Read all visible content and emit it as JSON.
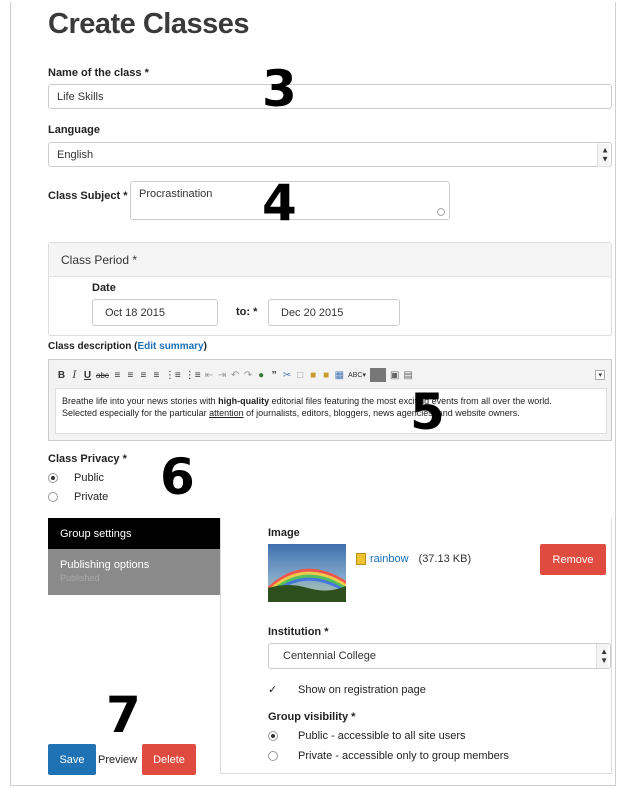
{
  "page": {
    "title": "Create Classes"
  },
  "class_name": {
    "label": "Name of the class *",
    "value": "Life Skills"
  },
  "language": {
    "label": "Language",
    "value": "English"
  },
  "subject": {
    "label": "Class Subject *",
    "value": "Procrastination"
  },
  "period": {
    "heading": "Class Period *",
    "date_label": "Date",
    "from": "Oct 18 2015",
    "to_label": "to: *",
    "to": "Dec 20 2015"
  },
  "description": {
    "label": "Class description (",
    "edit_link": "Edit summary",
    "label_close": ")",
    "text_part1": "Breathe life into your news stories with ",
    "text_bold": "high-quality",
    "text_part2": " editorial files featuring the most exciting events from all over the world.",
    "text_line2_a": "Selected especially for the particular ",
    "text_underline": "attention",
    "text_line2_b": " of journalists, editors, bloggers, news agencies, and website owners."
  },
  "privacy": {
    "label": "Class Privacy *",
    "options": [
      "Public",
      "Private"
    ],
    "selected": "Public"
  },
  "tabs": {
    "group_settings": "Group settings",
    "publishing_options": "Publishing options",
    "publishing_status": "Published"
  },
  "image": {
    "label": "Image",
    "file_name": "rainbow",
    "file_size": "(37.13 KB)",
    "remove_label": "Remove"
  },
  "institution": {
    "label": "Institution *",
    "value": "Centennial College"
  },
  "registration": {
    "label": "Show on registration page",
    "checked": true
  },
  "group_visibility": {
    "label": "Group visibility *",
    "options": [
      "Public - accessible to all site users",
      "Private - accessible only to group members"
    ],
    "selected": "Public - accessible to all site users"
  },
  "actions": {
    "save": "Save",
    "preview": "Preview",
    "delete": "Delete"
  },
  "annotations": [
    "3",
    "4",
    "5",
    "6",
    "7"
  ],
  "colors": {
    "link": "#1a6fb5",
    "danger": "#e04b3f",
    "primary": "#1f73b5",
    "tab_active": "#000000",
    "tab_inactive": "#8a8a8a"
  }
}
